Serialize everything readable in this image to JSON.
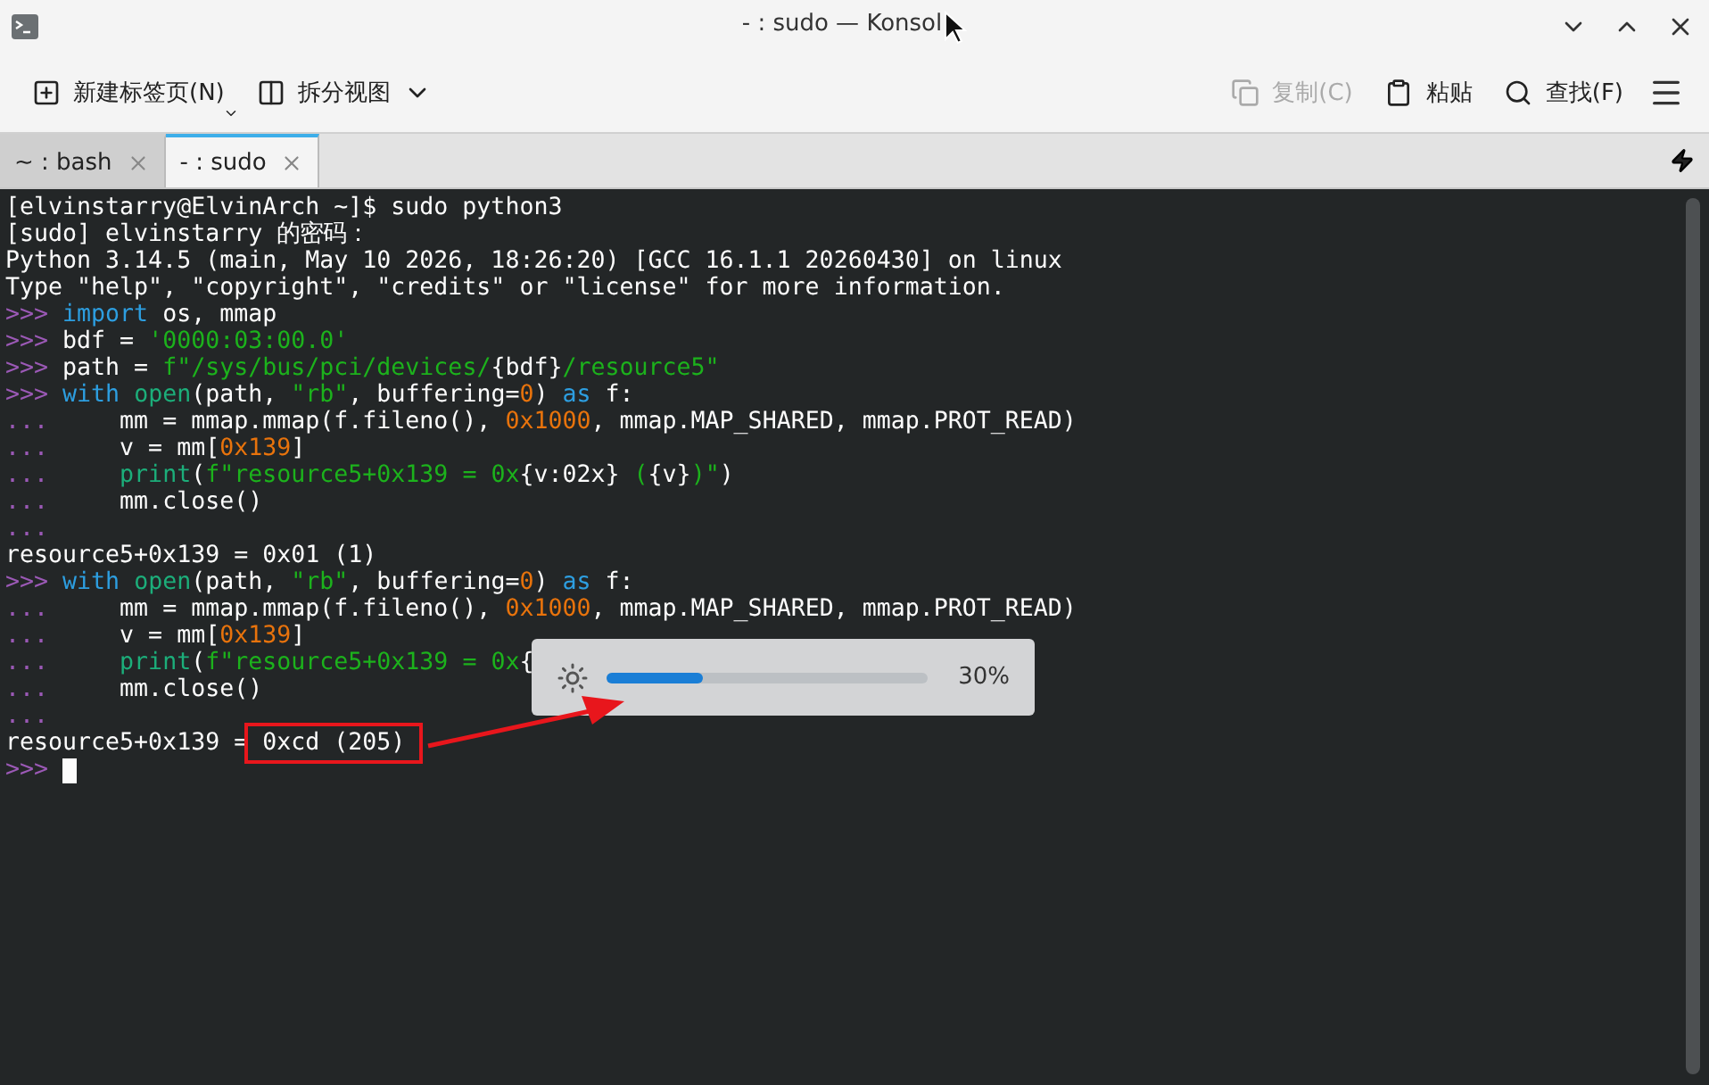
{
  "window": {
    "title": "- : sudo — Konsol"
  },
  "toolbar": {
    "left": [
      {
        "label": "新建标签页(N)",
        "kind": "new-tab",
        "disabled": false
      },
      {
        "label": "拆分视图",
        "kind": "split",
        "disabled": false
      }
    ],
    "right": [
      {
        "label": "复制(C)",
        "kind": "copy",
        "disabled": true
      },
      {
        "label": "粘贴",
        "kind": "paste",
        "disabled": false
      },
      {
        "label": "查找(F)",
        "kind": "find",
        "disabled": false
      }
    ]
  },
  "tabs": [
    {
      "label": "~ : bash",
      "selected": false
    },
    {
      "label": "- : sudo",
      "selected": true
    }
  ],
  "terminal": {
    "lines": [
      [
        {
          "t": "[elvinstarry@ElvinArch ~]$ sudo python3",
          "kind": "plain"
        }
      ],
      [
        {
          "t": "[sudo] elvinstarry 的密码：",
          "kind": "plain"
        }
      ],
      [
        {
          "t": "Python 3.14.5 (main, May 10 2026, 18:26:20) [GCC 16.1.1 20260430] on linux",
          "kind": "plain"
        }
      ],
      [
        {
          "t": "Type \"help\", \"copyright\", \"credits\" or \"license\" for more information.",
          "kind": "plain"
        }
      ],
      [
        {
          "t": ">>> ",
          "kind": "prompt"
        },
        {
          "t": "import",
          "kind": "keyword"
        },
        {
          "t": " os, mmap",
          "kind": "plain"
        }
      ],
      [
        {
          "t": ">>> ",
          "kind": "prompt"
        },
        {
          "t": "bdf = ",
          "kind": "plain"
        },
        {
          "t": "'0000:03:00.0'",
          "kind": "string"
        }
      ],
      [
        {
          "t": ">>> ",
          "kind": "prompt"
        },
        {
          "t": "path = ",
          "kind": "plain"
        },
        {
          "t": "f\"/sys/bus/pci/devices/",
          "kind": "string"
        },
        {
          "t": "{bdf}",
          "kind": "plain"
        },
        {
          "t": "/resource5\"",
          "kind": "string"
        }
      ],
      [
        {
          "t": ">>> ",
          "kind": "prompt"
        },
        {
          "t": "with ",
          "kind": "keyword"
        },
        {
          "t": "open",
          "kind": "builtin"
        },
        {
          "t": "(path, ",
          "kind": "plain"
        },
        {
          "t": "\"rb\"",
          "kind": "string"
        },
        {
          "t": ", buffering=",
          "kind": "plain"
        },
        {
          "t": "0",
          "kind": "number"
        },
        {
          "t": ") ",
          "kind": "plain"
        },
        {
          "t": "as",
          "kind": "keyword"
        },
        {
          "t": " f:",
          "kind": "plain"
        }
      ],
      [
        {
          "t": "...     ",
          "kind": "prompt"
        },
        {
          "t": "mm = mmap.mmap(f.fileno(), ",
          "kind": "plain"
        },
        {
          "t": "0x1000",
          "kind": "number"
        },
        {
          "t": ", mmap.MAP_SHARED, mmap.PROT_READ)",
          "kind": "plain"
        }
      ],
      [
        {
          "t": "...     ",
          "kind": "prompt"
        },
        {
          "t": "v = mm[",
          "kind": "plain"
        },
        {
          "t": "0x139",
          "kind": "number"
        },
        {
          "t": "]",
          "kind": "plain"
        }
      ],
      [
        {
          "t": "...     ",
          "kind": "prompt"
        },
        {
          "t": "print",
          "kind": "builtin"
        },
        {
          "t": "(",
          "kind": "plain"
        },
        {
          "t": "f\"resource5+0x139 = 0x",
          "kind": "string"
        },
        {
          "t": "{v:02x}",
          "kind": "plain"
        },
        {
          "t": " (",
          "kind": "string"
        },
        {
          "t": "{v}",
          "kind": "plain"
        },
        {
          "t": ")\"",
          "kind": "string"
        },
        {
          "t": ")",
          "kind": "plain"
        }
      ],
      [
        {
          "t": "...     ",
          "kind": "prompt"
        },
        {
          "t": "mm.close()",
          "kind": "plain"
        }
      ],
      [
        {
          "t": "...",
          "kind": "prompt"
        }
      ],
      [
        {
          "t": "resource5+0x139 = 0x01 (1)",
          "kind": "plain"
        }
      ],
      [
        {
          "t": ">>> ",
          "kind": "prompt"
        },
        {
          "t": "with ",
          "kind": "keyword"
        },
        {
          "t": "open",
          "kind": "builtin"
        },
        {
          "t": "(path, ",
          "kind": "plain"
        },
        {
          "t": "\"rb\"",
          "kind": "string"
        },
        {
          "t": ", buffering=",
          "kind": "plain"
        },
        {
          "t": "0",
          "kind": "number"
        },
        {
          "t": ") ",
          "kind": "plain"
        },
        {
          "t": "as",
          "kind": "keyword"
        },
        {
          "t": " f:",
          "kind": "plain"
        }
      ],
      [
        {
          "t": "...     ",
          "kind": "prompt"
        },
        {
          "t": "mm = mmap.mmap(f.fileno(), ",
          "kind": "plain"
        },
        {
          "t": "0x1000",
          "kind": "number"
        },
        {
          "t": ", mmap.MAP_SHARED, mmap.PROT_READ)",
          "kind": "plain"
        }
      ],
      [
        {
          "t": "...     ",
          "kind": "prompt"
        },
        {
          "t": "v = mm[",
          "kind": "plain"
        },
        {
          "t": "0x139",
          "kind": "number"
        },
        {
          "t": "]",
          "kind": "plain"
        }
      ],
      [
        {
          "t": "...     ",
          "kind": "prompt"
        },
        {
          "t": "print",
          "kind": "builtin"
        },
        {
          "t": "(",
          "kind": "plain"
        },
        {
          "t": "f\"resource5+0x139 = 0x",
          "kind": "string"
        },
        {
          "t": "{",
          "kind": "plain"
        }
      ],
      [
        {
          "t": "...     ",
          "kind": "prompt"
        },
        {
          "t": "mm.close()",
          "kind": "plain"
        }
      ],
      [
        {
          "t": "...",
          "kind": "prompt"
        }
      ],
      [
        {
          "t": "resource5+0x139 = ",
          "kind": "plain"
        },
        {
          "t": "0xcd (205)",
          "kind": "boxed"
        }
      ],
      [
        {
          "t": ">>> ",
          "kind": "prompt"
        }
      ]
    ]
  },
  "osd": {
    "level": 0.3,
    "reading": "30%"
  }
}
